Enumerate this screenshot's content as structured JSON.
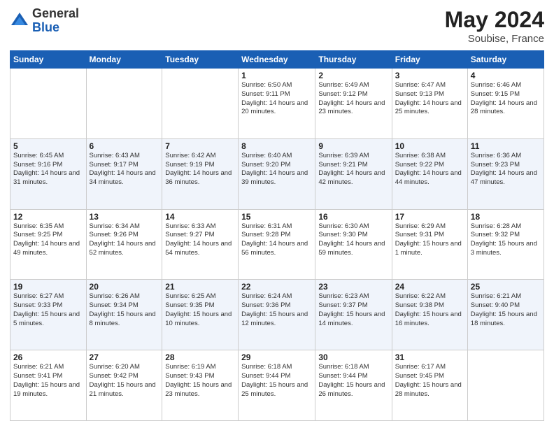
{
  "header": {
    "logo_general": "General",
    "logo_blue": "Blue",
    "month": "May 2024",
    "location": "Soubise, France"
  },
  "days_of_week": [
    "Sunday",
    "Monday",
    "Tuesday",
    "Wednesday",
    "Thursday",
    "Friday",
    "Saturday"
  ],
  "weeks": [
    [
      {
        "day": "",
        "info": ""
      },
      {
        "day": "",
        "info": ""
      },
      {
        "day": "",
        "info": ""
      },
      {
        "day": "1",
        "info": "Sunrise: 6:50 AM\nSunset: 9:11 PM\nDaylight: 14 hours\nand 20 minutes."
      },
      {
        "day": "2",
        "info": "Sunrise: 6:49 AM\nSunset: 9:12 PM\nDaylight: 14 hours\nand 23 minutes."
      },
      {
        "day": "3",
        "info": "Sunrise: 6:47 AM\nSunset: 9:13 PM\nDaylight: 14 hours\nand 25 minutes."
      },
      {
        "day": "4",
        "info": "Sunrise: 6:46 AM\nSunset: 9:15 PM\nDaylight: 14 hours\nand 28 minutes."
      }
    ],
    [
      {
        "day": "5",
        "info": "Sunrise: 6:45 AM\nSunset: 9:16 PM\nDaylight: 14 hours\nand 31 minutes."
      },
      {
        "day": "6",
        "info": "Sunrise: 6:43 AM\nSunset: 9:17 PM\nDaylight: 14 hours\nand 34 minutes."
      },
      {
        "day": "7",
        "info": "Sunrise: 6:42 AM\nSunset: 9:19 PM\nDaylight: 14 hours\nand 36 minutes."
      },
      {
        "day": "8",
        "info": "Sunrise: 6:40 AM\nSunset: 9:20 PM\nDaylight: 14 hours\nand 39 minutes."
      },
      {
        "day": "9",
        "info": "Sunrise: 6:39 AM\nSunset: 9:21 PM\nDaylight: 14 hours\nand 42 minutes."
      },
      {
        "day": "10",
        "info": "Sunrise: 6:38 AM\nSunset: 9:22 PM\nDaylight: 14 hours\nand 44 minutes."
      },
      {
        "day": "11",
        "info": "Sunrise: 6:36 AM\nSunset: 9:23 PM\nDaylight: 14 hours\nand 47 minutes."
      }
    ],
    [
      {
        "day": "12",
        "info": "Sunrise: 6:35 AM\nSunset: 9:25 PM\nDaylight: 14 hours\nand 49 minutes."
      },
      {
        "day": "13",
        "info": "Sunrise: 6:34 AM\nSunset: 9:26 PM\nDaylight: 14 hours\nand 52 minutes."
      },
      {
        "day": "14",
        "info": "Sunrise: 6:33 AM\nSunset: 9:27 PM\nDaylight: 14 hours\nand 54 minutes."
      },
      {
        "day": "15",
        "info": "Sunrise: 6:31 AM\nSunset: 9:28 PM\nDaylight: 14 hours\nand 56 minutes."
      },
      {
        "day": "16",
        "info": "Sunrise: 6:30 AM\nSunset: 9:30 PM\nDaylight: 14 hours\nand 59 minutes."
      },
      {
        "day": "17",
        "info": "Sunrise: 6:29 AM\nSunset: 9:31 PM\nDaylight: 15 hours\nand 1 minute."
      },
      {
        "day": "18",
        "info": "Sunrise: 6:28 AM\nSunset: 9:32 PM\nDaylight: 15 hours\nand 3 minutes."
      }
    ],
    [
      {
        "day": "19",
        "info": "Sunrise: 6:27 AM\nSunset: 9:33 PM\nDaylight: 15 hours\nand 5 minutes."
      },
      {
        "day": "20",
        "info": "Sunrise: 6:26 AM\nSunset: 9:34 PM\nDaylight: 15 hours\nand 8 minutes."
      },
      {
        "day": "21",
        "info": "Sunrise: 6:25 AM\nSunset: 9:35 PM\nDaylight: 15 hours\nand 10 minutes."
      },
      {
        "day": "22",
        "info": "Sunrise: 6:24 AM\nSunset: 9:36 PM\nDaylight: 15 hours\nand 12 minutes."
      },
      {
        "day": "23",
        "info": "Sunrise: 6:23 AM\nSunset: 9:37 PM\nDaylight: 15 hours\nand 14 minutes."
      },
      {
        "day": "24",
        "info": "Sunrise: 6:22 AM\nSunset: 9:38 PM\nDaylight: 15 hours\nand 16 minutes."
      },
      {
        "day": "25",
        "info": "Sunrise: 6:21 AM\nSunset: 9:40 PM\nDaylight: 15 hours\nand 18 minutes."
      }
    ],
    [
      {
        "day": "26",
        "info": "Sunrise: 6:21 AM\nSunset: 9:41 PM\nDaylight: 15 hours\nand 19 minutes."
      },
      {
        "day": "27",
        "info": "Sunrise: 6:20 AM\nSunset: 9:42 PM\nDaylight: 15 hours\nand 21 minutes."
      },
      {
        "day": "28",
        "info": "Sunrise: 6:19 AM\nSunset: 9:43 PM\nDaylight: 15 hours\nand 23 minutes."
      },
      {
        "day": "29",
        "info": "Sunrise: 6:18 AM\nSunset: 9:44 PM\nDaylight: 15 hours\nand 25 minutes."
      },
      {
        "day": "30",
        "info": "Sunrise: 6:18 AM\nSunset: 9:44 PM\nDaylight: 15 hours\nand 26 minutes."
      },
      {
        "day": "31",
        "info": "Sunrise: 6:17 AM\nSunset: 9:45 PM\nDaylight: 15 hours\nand 28 minutes."
      },
      {
        "day": "",
        "info": ""
      }
    ]
  ]
}
